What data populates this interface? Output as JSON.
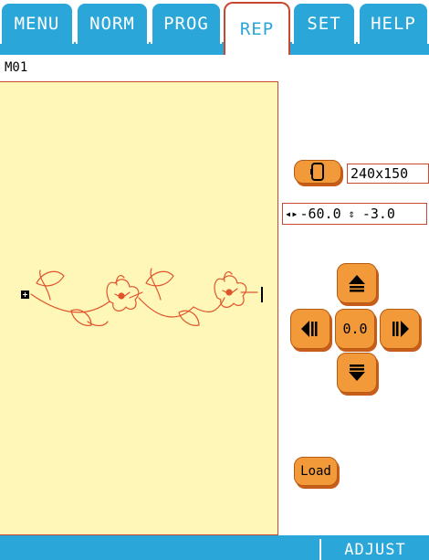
{
  "tabs": [
    {
      "label": "MENU",
      "active": false
    },
    {
      "label": "NORM",
      "active": false
    },
    {
      "label": "PROG",
      "active": false
    },
    {
      "label": "REP",
      "active": true
    },
    {
      "label": "SET",
      "active": false
    },
    {
      "label": "HELP",
      "active": false
    }
  ],
  "pattern_name": "M01",
  "size_display": "240x150",
  "offset": {
    "x": "-60.0",
    "y": "-3.0"
  },
  "move_pad": {
    "center_label": "0.0"
  },
  "load_label": "Load",
  "bottom": {
    "adjust_label": "ADJUST"
  },
  "colors": {
    "tab_blue": "#2aa7d8",
    "accent_orange": "#f29a3a",
    "border_red": "#c8472e",
    "sewing_area": "#fff7b8",
    "embroidery": "#e0542c"
  },
  "icons": {
    "hoop": "hoop-icon",
    "up": "move-up-icon",
    "down": "move-down-icon",
    "left": "move-left-icon",
    "right": "move-right-icon",
    "start_marker": "start-point-icon",
    "end_marker": "end-point-icon"
  }
}
